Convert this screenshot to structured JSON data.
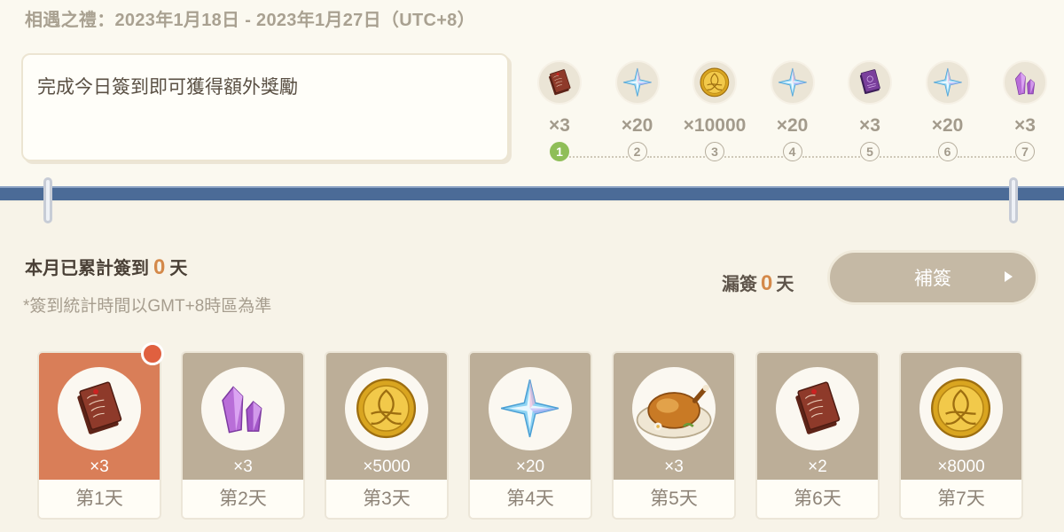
{
  "event": {
    "title": "相遇之禮：2023年1月18日 - 2023年1月27日（UTC+8）"
  },
  "task": {
    "text": "完成今日簽到即可獲得額外獎勵"
  },
  "milestones": [
    {
      "num": "1",
      "qty": "×3",
      "item": "letter-icon",
      "done": true
    },
    {
      "num": "2",
      "qty": "×20",
      "item": "star-gem-icon",
      "done": false
    },
    {
      "num": "3",
      "qty": "×10000",
      "item": "gold-coin-icon",
      "done": false
    },
    {
      "num": "4",
      "qty": "×20",
      "item": "star-gem-icon",
      "done": false
    },
    {
      "num": "5",
      "qty": "×3",
      "item": "purple-book-icon",
      "done": false
    },
    {
      "num": "6",
      "qty": "×20",
      "item": "star-gem-icon",
      "done": false
    },
    {
      "num": "7",
      "qty": "×3",
      "item": "purple-crystal-icon",
      "done": false
    }
  ],
  "checkin": {
    "monthly_label": "本月已累計簽到",
    "monthly_count": "0",
    "monthly_unit": "天",
    "note": "*簽到統計時間以GMT+8時區為準",
    "missed_label": "漏簽",
    "missed_count": "0",
    "missed_unit": "天",
    "makeup_label": "補簽"
  },
  "days": [
    {
      "qty": "×3",
      "label": "第1天",
      "item": "letter-icon",
      "today": true
    },
    {
      "qty": "×3",
      "label": "第2天",
      "item": "purple-crystal-icon",
      "today": false
    },
    {
      "qty": "×5000",
      "label": "第3天",
      "item": "gold-coin-icon",
      "today": false
    },
    {
      "qty": "×20",
      "label": "第4天",
      "item": "star-gem-icon",
      "today": false
    },
    {
      "qty": "×3",
      "label": "第5天",
      "item": "roast-chicken-icon",
      "today": false
    },
    {
      "qty": "×2",
      "label": "第6天",
      "item": "letter-icon",
      "today": false
    },
    {
      "qty": "×8000",
      "label": "第7天",
      "item": "gold-coin-icon",
      "today": false
    }
  ],
  "colors": {
    "accent_orange": "#d97e58",
    "count_orange": "#d4894a",
    "done_green": "#8fbe58",
    "band_blue": "#4b6b97",
    "card_tan": "#bcae98"
  }
}
